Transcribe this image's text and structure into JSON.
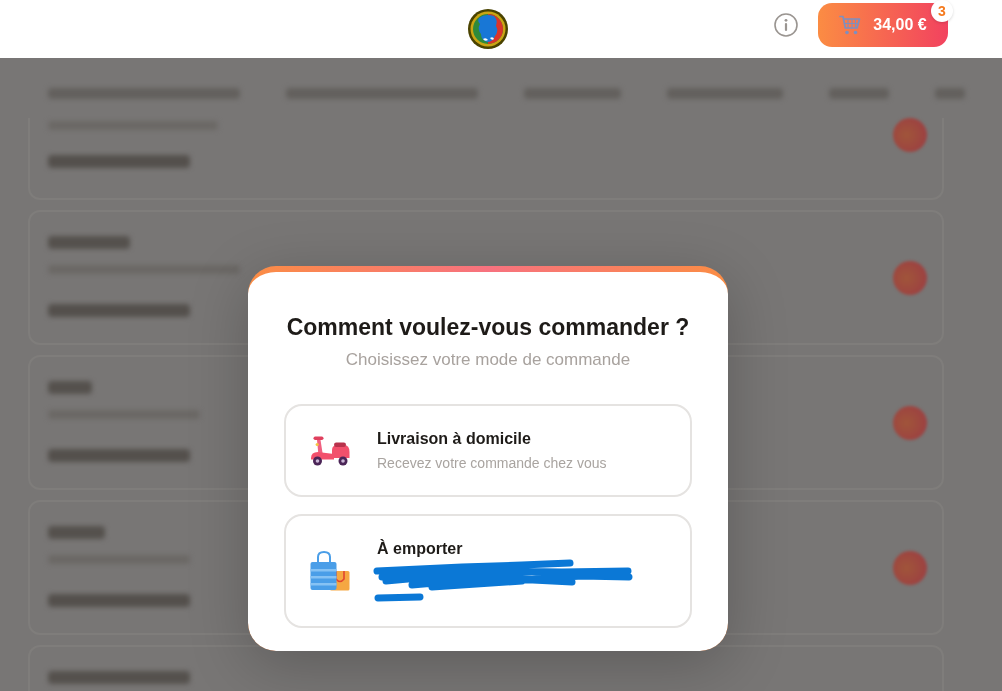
{
  "header": {
    "cart": {
      "total": "34,00 €",
      "count": "3"
    }
  },
  "dialog": {
    "title": "Comment voulez-vous commander ?",
    "subtitle": "Choisissez votre mode de commande",
    "options": [
      {
        "kind": "delivery",
        "title": "Livraison à domicile",
        "subtitle": "Recevez votre commande chez vous",
        "redacted": false
      },
      {
        "kind": "takeaway",
        "title": "À emporter",
        "redacted": true
      }
    ]
  }
}
